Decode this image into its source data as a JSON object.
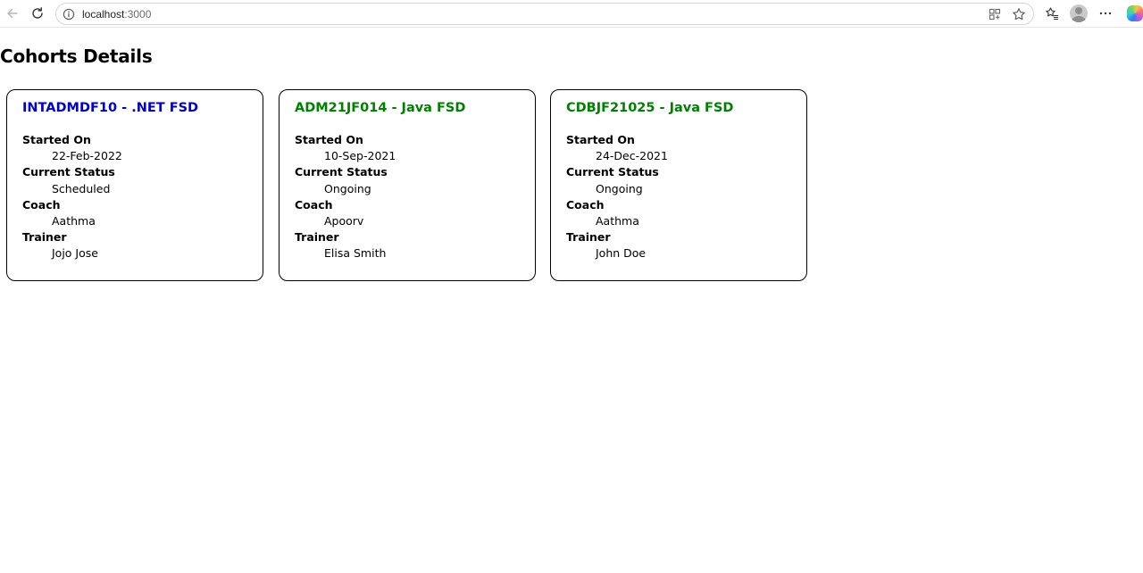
{
  "browser": {
    "url_host": "localhost",
    "url_port": ":3000"
  },
  "page": {
    "title": "Cohorts Details"
  },
  "cohorts": [
    {
      "title": "INTADMDF10 - .NET FSD",
      "title_color": "#0000cc",
      "fields": [
        {
          "label": "Started On",
          "value": "22-Feb-2022"
        },
        {
          "label": "Current Status",
          "value": "Scheduled"
        },
        {
          "label": "Coach",
          "value": "Aathma"
        },
        {
          "label": "Trainer",
          "value": "Jojo Jose"
        }
      ]
    },
    {
      "title": "ADM21JF014 - Java FSD",
      "title_color": "#008000",
      "fields": [
        {
          "label": "Started On",
          "value": "10-Sep-2021"
        },
        {
          "label": "Current Status",
          "value": "Ongoing"
        },
        {
          "label": "Coach",
          "value": "Apoorv"
        },
        {
          "label": "Trainer",
          "value": "Elisa Smith"
        }
      ]
    },
    {
      "title": "CDBJF21025 - Java FSD",
      "title_color": "#008000",
      "fields": [
        {
          "label": "Started On",
          "value": "24-Dec-2021"
        },
        {
          "label": "Current Status",
          "value": "Ongoing"
        },
        {
          "label": "Coach",
          "value": "Aathma"
        },
        {
          "label": "Trainer",
          "value": "John Doe"
        }
      ]
    }
  ]
}
